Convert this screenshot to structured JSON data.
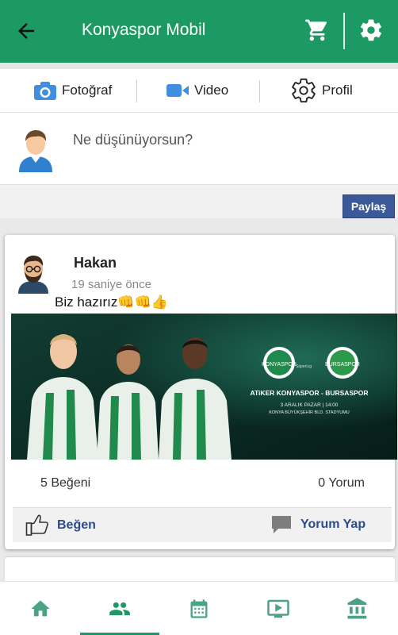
{
  "app": {
    "title": "Konyaspor Mobil",
    "accent_color": "#1d9a63",
    "icons": [
      "back-arrow-icon",
      "cart-icon",
      "gear-icon"
    ]
  },
  "composer": {
    "media_buttons": [
      {
        "label": "Fotoğraf",
        "icon": "camera-icon"
      },
      {
        "label": "Video",
        "icon": "video-camera-icon"
      },
      {
        "label": "Profil",
        "icon": "cog-icon"
      }
    ],
    "placeholder": "Ne düşünüyorsun?",
    "submit_label": "Paylaş"
  },
  "post": {
    "author": "Hakan",
    "time": "19 saniye önce",
    "text": "Biz hazırız👊👊👍",
    "banner": {
      "match_title": "ATiKER KONYASPOR - BURSASPOR",
      "match_date": "3 ARALIK PAZAR | 14:00",
      "venue": "KONYA BÜYÜKŞEHİR BLD. STADYUMU",
      "league": "SüperLig",
      "home_crest": "KONYASPOR",
      "away_crest": "BURSASPOR"
    },
    "likes_text": "5 Beğeni",
    "comments_text": "0 Yorum",
    "like_label": "Beğen",
    "comment_label": "Yorum Yap"
  },
  "bottom_nav": {
    "items": [
      {
        "icon": "home-icon",
        "active": false
      },
      {
        "icon": "people-icon",
        "active": true
      },
      {
        "icon": "calendar-icon",
        "active": false
      },
      {
        "icon": "tv-icon",
        "active": false
      },
      {
        "icon": "bank-icon",
        "active": false
      }
    ],
    "active_color": "#1d9a63",
    "inactive_color": "#4aa383"
  }
}
